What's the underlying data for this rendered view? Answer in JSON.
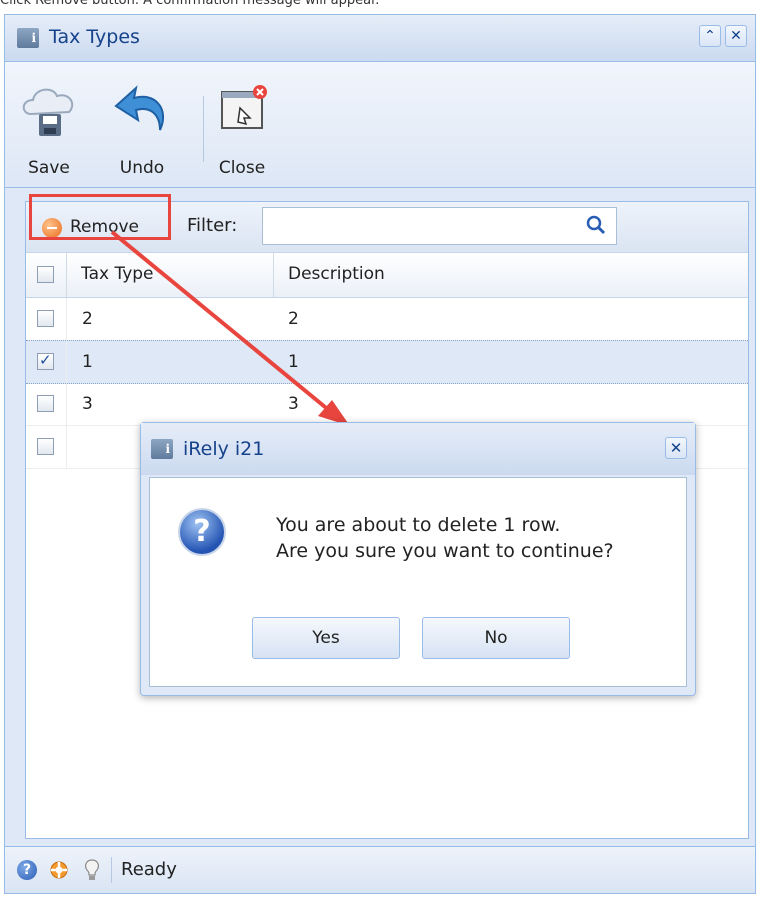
{
  "caption": "Click Remove button. A confirmation message will appear.",
  "window": {
    "title": "Tax Types"
  },
  "toolbar": {
    "save_label": "Save",
    "undo_label": "Undo",
    "close_label": "Close"
  },
  "grid": {
    "remove_label": "Remove",
    "filter_label": "Filter:",
    "filter_value": "",
    "columns": [
      "Tax Type",
      "Description"
    ],
    "rows": [
      {
        "tax_type": "2",
        "description": "2",
        "checked": false
      },
      {
        "tax_type": "1",
        "description": "1",
        "checked": true
      },
      {
        "tax_type": "3",
        "description": "3",
        "checked": false
      },
      {
        "tax_type": "",
        "description": "",
        "checked": false
      }
    ]
  },
  "status": {
    "text": "Ready"
  },
  "dialog": {
    "title": "iRely i21",
    "message_line1": "You are about to delete 1 row.",
    "message_line2": "Are you sure you want to continue?",
    "yes_label": "Yes",
    "no_label": "No"
  },
  "colors": {
    "highlight": "#e8453f",
    "frame": "#99bbe8",
    "title_text": "#15428b"
  }
}
